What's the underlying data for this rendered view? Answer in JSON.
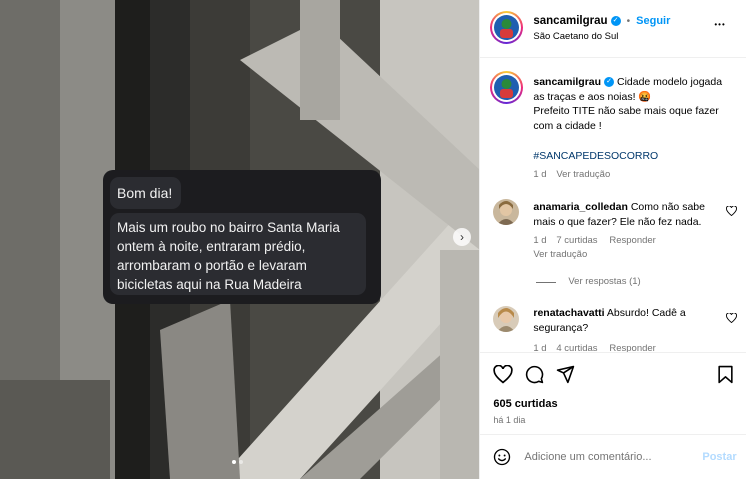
{
  "post": {
    "bubble_1": "Bom dia!",
    "bubble_2": "Mais um roubo no bairro Santa Maria ontem à noite, entraram prédio, arrombaram o portão e levaram bicicletas aqui na Rua Madeira"
  },
  "header": {
    "username": "sancamilgrau",
    "separator": "•",
    "follow_label": "Seguir",
    "location": "São Caetano do Sul",
    "more_label": "•••"
  },
  "caption": {
    "username": "sancamilgrau",
    "text_line1": "Cidade modelo jogada",
    "text_line2": "as traças e aos noias! 🤬",
    "text_line3": "Prefeito TITE não sabe mais oque fazer",
    "text_line4": "com a cidade !",
    "hashtag": "#SANCAPEDESOCORRO",
    "age": "1 d",
    "translate": "Ver tradução"
  },
  "comments": [
    {
      "username": "anamaria_colledan",
      "text_a": "Como não sabe",
      "text_b": "mais o que fazer? Ele não fez nada.",
      "age": "1 d",
      "likes": "7 curtidas",
      "reply": "Responder",
      "translate": "Ver tradução",
      "view_replies": "Ver respostas (1)"
    },
    {
      "username": "renatachavatti",
      "text_a": "Absurdo! Cadê a",
      "text_b": "segurança?",
      "age": "1 d",
      "likes": "4 curtidas",
      "reply": "Responder"
    }
  ],
  "stats": {
    "likes": "605 curtidas",
    "age": "há 1 dia"
  },
  "add_comment": {
    "placeholder": "Adicione um comentário...",
    "post_label": "Postar"
  },
  "colors": {
    "accent": "#0095f6",
    "muted": "#737373"
  }
}
